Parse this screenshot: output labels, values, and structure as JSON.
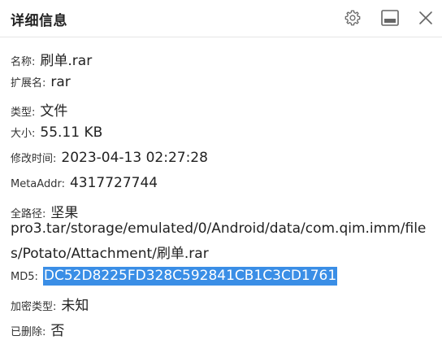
{
  "header": {
    "title": "详细信息",
    "icons": [
      "gear-icon",
      "minimize-icon",
      "close-icon"
    ]
  },
  "details": {
    "name": {
      "label": "名称:",
      "value": "刷单.rar"
    },
    "extension": {
      "label": "扩展名:",
      "value": "rar"
    },
    "type": {
      "label": "类型:",
      "value": "文件"
    },
    "size": {
      "label": "大小:",
      "value": "55.11 KB"
    },
    "modified": {
      "label": "修改时间:",
      "value": "2023-04-13 02:27:28"
    },
    "meta_addr": {
      "label": "MetaAddr:",
      "value": "4317727744"
    },
    "full_path": {
      "label": "全路径:",
      "value_line1": "坚果",
      "value_line2": "pro3.tar/storage/emulated/0/Android/data/com.qim.imm/file",
      "value_line3": "s/Potato/Attachment/刷单.rar"
    },
    "md5": {
      "label": "MD5:",
      "value": "DC52D8225FD328C592841CB1C3CD1761"
    },
    "encryption": {
      "label": "加密类型:",
      "value": "未知"
    },
    "deleted": {
      "label": "已删除:",
      "value": "否"
    }
  },
  "colors": {
    "selection": "#3a8ee6",
    "divider": "#e6e6e6",
    "icon": "#666666"
  }
}
